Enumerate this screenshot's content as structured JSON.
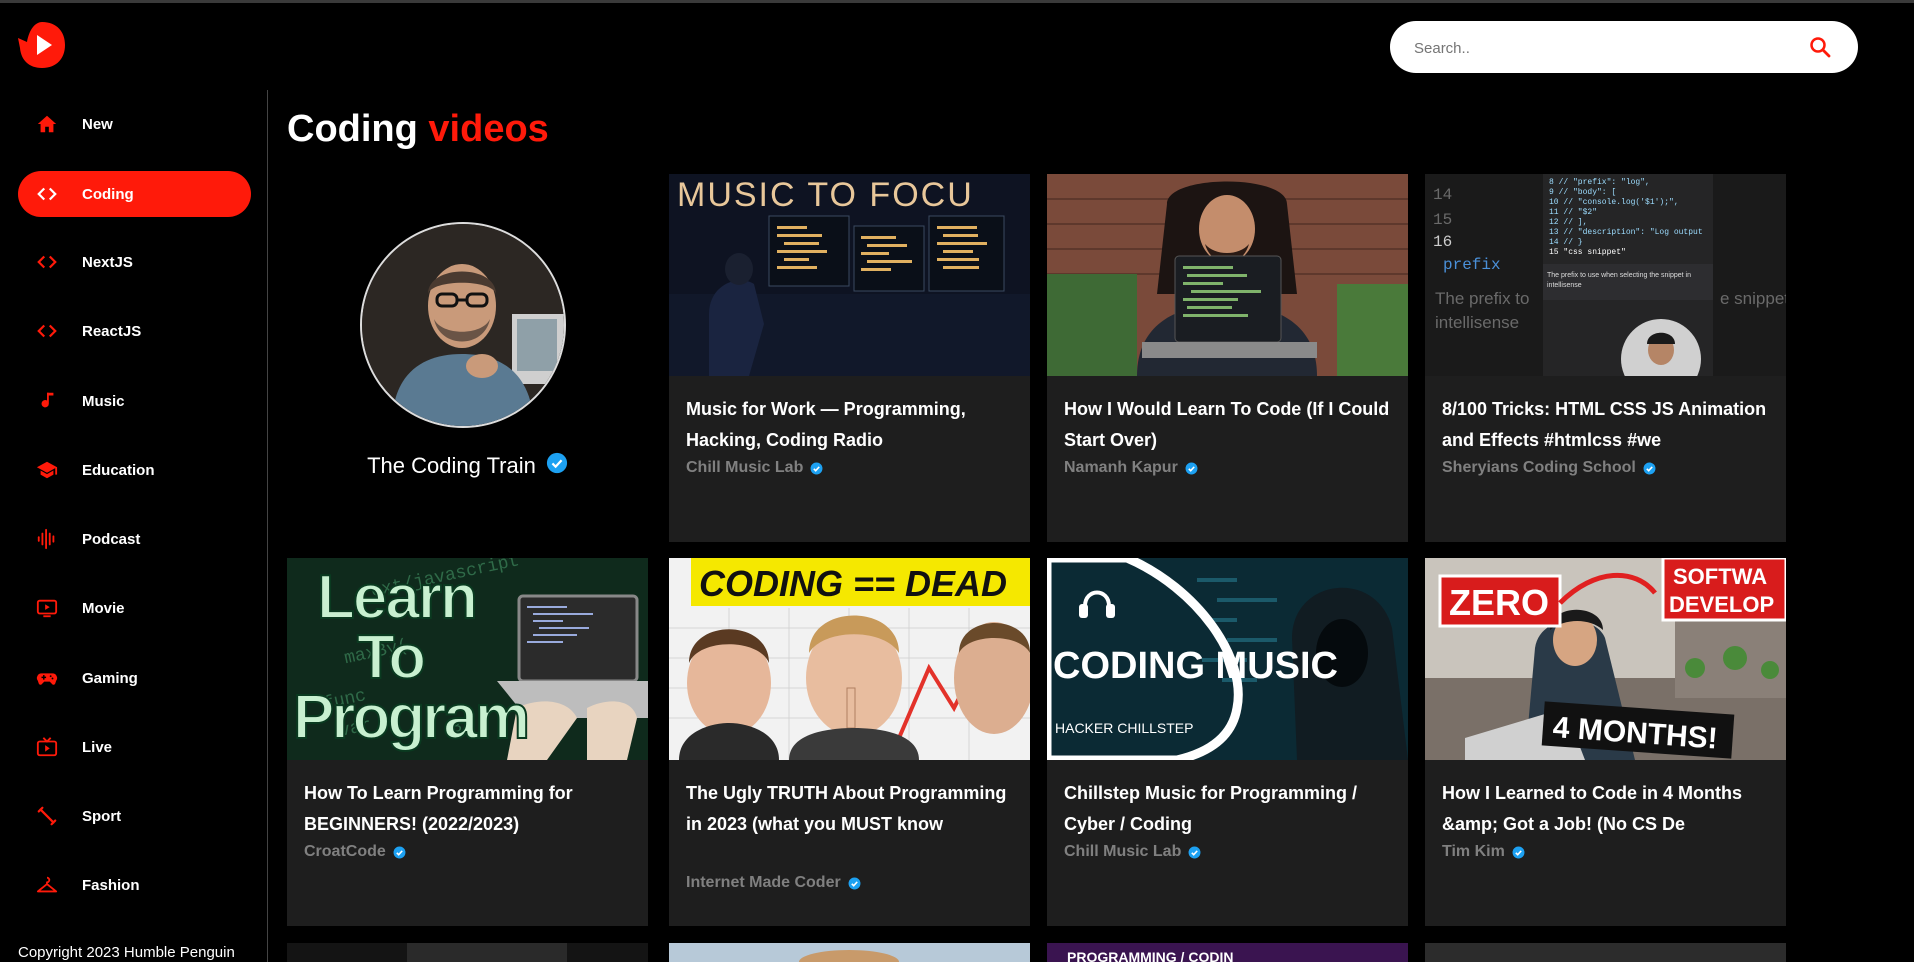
{
  "search": {
    "placeholder": "Search.."
  },
  "sidebar": {
    "items": [
      {
        "label": "New",
        "icon": "home-icon"
      },
      {
        "label": "Coding",
        "icon": "code-icon",
        "active": true
      },
      {
        "label": "NextJS",
        "icon": "code-icon"
      },
      {
        "label": "ReactJS",
        "icon": "code-icon"
      },
      {
        "label": "Music",
        "icon": "music-note-icon"
      },
      {
        "label": "Education",
        "icon": "graduation-cap-icon"
      },
      {
        "label": "Podcast",
        "icon": "podcast-icon"
      },
      {
        "label": "Movie",
        "icon": "movie-icon"
      },
      {
        "label": "Gaming",
        "icon": "gamepad-icon"
      },
      {
        "label": "Live",
        "icon": "live-tv-icon"
      },
      {
        "label": "Sport",
        "icon": "sport-icon"
      },
      {
        "label": "Fashion",
        "icon": "fashion-icon"
      }
    ],
    "copyright": "Copyright 2023 Humble Penguin"
  },
  "main": {
    "title_main": "Coding",
    "title_accent": "videos",
    "channel": {
      "name": "The Coding Train",
      "verified": true
    },
    "videos": [
      {
        "title": "Music for Work — Programming, Hacking, Coding Radio",
        "channel": "Chill Music Lab",
        "thumb_text": "MUSIC TO FOCU"
      },
      {
        "title": "How I Would Learn To Code (If I Could Start Over)",
        "channel": "Namanh Kapur",
        "thumb_text": ""
      },
      {
        "title": "8/100 Tricks: HTML CSS JS Animation and Effects #htmlcss #we",
        "channel": "Sheryians Coding School",
        "thumb_text": "prefix"
      },
      {
        "title": "How To Learn Programming for BEGINNERS! (2022/2023)",
        "channel": "CroatCode",
        "thumb_text": "Learn To Program"
      },
      {
        "title": "The Ugly TRUTH About Programming in 2023 (what you MUST know",
        "channel": "Internet Made Coder",
        "thumb_text": "CODING == DEAD"
      },
      {
        "title": "Chillstep Music for Programming / Cyber / Coding",
        "channel": "Chill Music Lab",
        "thumb_text": "CODING MUSIC"
      },
      {
        "title": "How I Learned to Code in 4 Months &amp; Got a Job! (No CS De",
        "channel": "Tim Kim",
        "thumb_text": "ZERO"
      }
    ]
  },
  "colors": {
    "accent": "#ff1a0a",
    "verified": "#1da1f2",
    "card_bg": "#1e1e1e",
    "muted": "#808080"
  }
}
